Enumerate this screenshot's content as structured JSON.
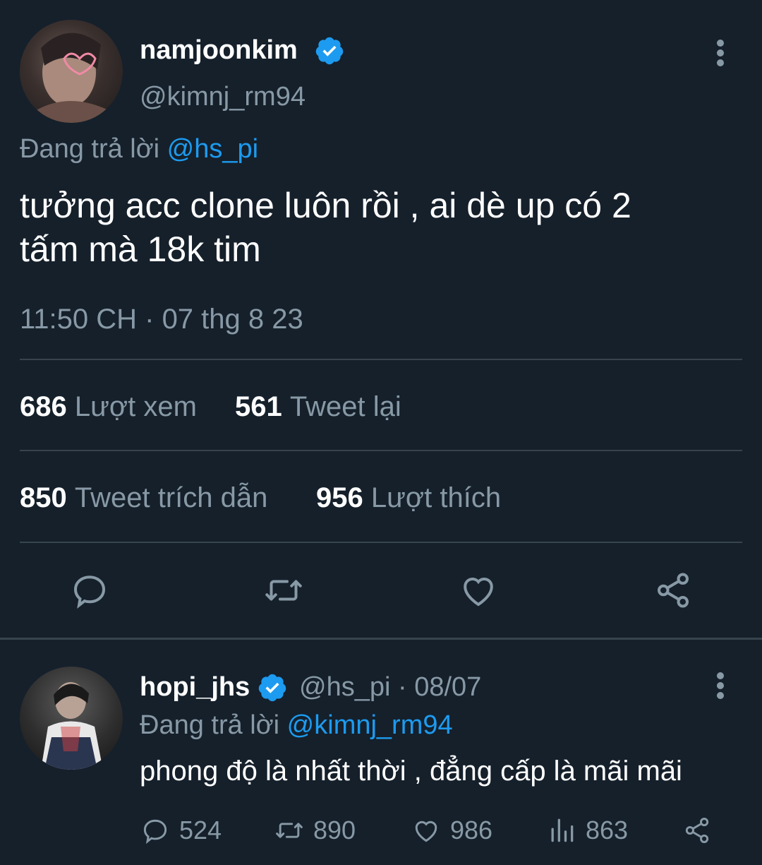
{
  "tweet": {
    "display_name": "namjoonkim",
    "handle": "@kimnj_rm94",
    "replying_prefix": "Đang trả lời ",
    "replying_to": "@hs_pi",
    "text_line1": "tưởng acc clone luôn rồi , ai dè up có 2",
    "text_line2": "tấm mà 18k tim",
    "timestamp": "11:50 CH · 07 thg 8 23",
    "stats": {
      "views_count": "686",
      "views_label": "Lượt xem",
      "retweets_count": "561",
      "retweets_label": "Tweet lại",
      "quotes_count": "850",
      "quotes_label": "Tweet trích dẫn",
      "likes_count": "956",
      "likes_label": "Lượt thích"
    },
    "actions": [
      "reply-icon",
      "retweet-icon",
      "like-icon",
      "share-icon"
    ]
  },
  "reply": {
    "display_name": "hopi_jhs",
    "handle_date": "@hs_pi · 08/07",
    "replying_prefix": "Đang trả lời ",
    "replying_to": "@kimnj_rm94",
    "text": "phong độ là nhất thời , đẳng cấp là mãi mãi",
    "counts": {
      "replies": "524",
      "retweets": "890",
      "likes": "986",
      "views": "863"
    }
  },
  "colors": {
    "background": "#15202b",
    "accent": "#1d9bf0",
    "muted": "#8899a6",
    "divider": "#38444d"
  }
}
